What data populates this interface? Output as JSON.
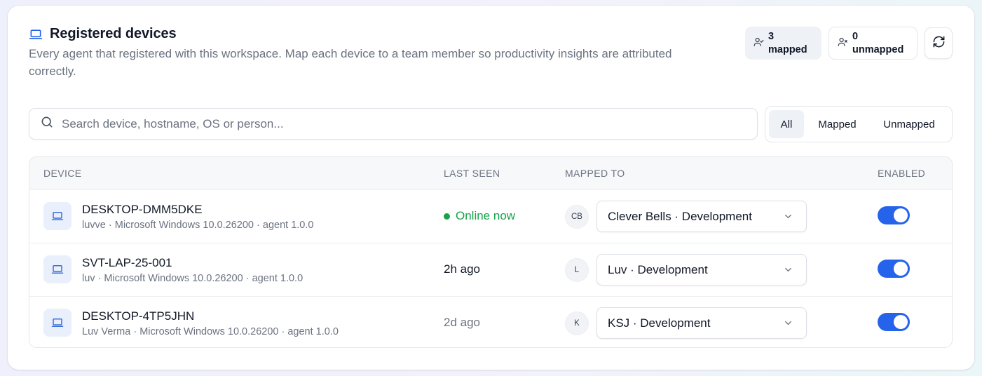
{
  "header": {
    "title": "Registered devices",
    "subtitle": "Every agent that registered with this workspace. Map each device to a team member so productivity insights are attributed correctly."
  },
  "stats": {
    "mapped_count": "3",
    "mapped_label": "mapped",
    "unmapped_count": "0",
    "unmapped_label": "unmapped"
  },
  "search": {
    "placeholder": "Search device, hostname, OS or person..."
  },
  "filters": {
    "all": "All",
    "mapped": "Mapped",
    "unmapped": "Unmapped",
    "active": "All"
  },
  "table": {
    "columns": {
      "device": "DEVICE",
      "last_seen": "LAST SEEN",
      "mapped_to": "MAPPED TO",
      "enabled": "ENABLED"
    },
    "rows": [
      {
        "name": "DESKTOP-DMM5DKE",
        "meta": "luvve · Microsoft Windows 10.0.26200 · agent 1.0.0",
        "last_seen": "Online now",
        "status": "online",
        "avatar": "CB",
        "mapped_to": "Clever Bells · Development",
        "enabled": true
      },
      {
        "name": "SVT-LAP-25-001",
        "meta": "luv · Microsoft Windows 10.0.26200 · agent 1.0.0",
        "last_seen": "2h ago",
        "status": "recent",
        "avatar": "L",
        "mapped_to": "Luv · Development",
        "enabled": true
      },
      {
        "name": "DESKTOP-4TP5JHN",
        "meta": "Luv Verma · Microsoft Windows 10.0.26200 · agent 1.0.0",
        "last_seen": "2d ago",
        "status": "stale",
        "avatar": "K",
        "mapped_to": "KSJ · Development",
        "enabled": true
      }
    ]
  },
  "colors": {
    "accent": "#2563eb",
    "online": "#16a34a",
    "muted_text": "#6b7280",
    "device_icon": "#3b6fd8"
  },
  "icons": {
    "title": "laptop-icon",
    "mapped": "user-check-icon",
    "unmapped": "user-x-icon",
    "refresh": "refresh-icon",
    "search": "search-icon",
    "device": "laptop-icon",
    "dropdown": "chevron-down-icon"
  }
}
